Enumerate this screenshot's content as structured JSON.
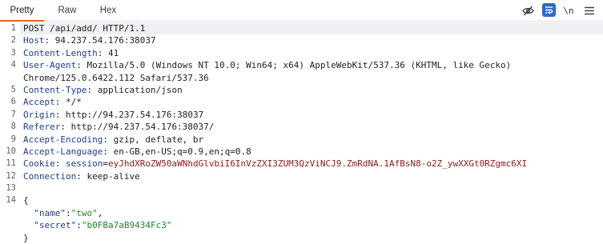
{
  "tabs": [
    "Pretty",
    "Raw",
    "Hex"
  ],
  "toolbar": {
    "hide_icon": "eye-slash-icon",
    "wrap_icon": "word-wrap-icon",
    "newline_label": "\\n",
    "accent": "#2f68c8"
  },
  "colors": {
    "active_tab_underline": "#e8622d",
    "header_name": "#1f3d8f",
    "cookie_value": "#8a1a1a",
    "json_string": "#178a26"
  },
  "line_numbers": [
    "1",
    "2",
    "3",
    "4",
    "",
    "5",
    "6",
    "7",
    "8",
    "9",
    "10",
    "11",
    "12",
    "13",
    "14",
    "",
    "",
    ""
  ],
  "request": {
    "request_line": "POST /api/add/ HTTP/1.1",
    "headers": [
      {
        "name": "Host",
        "value": "94.237.54.176:38037"
      },
      {
        "name": "Content-Length",
        "value": "41"
      },
      {
        "name": "User-Agent",
        "value": "Mozilla/5.0 (Windows NT 10.0; Win64; x64) AppleWebKit/537.36 (KHTML, like Gecko)"
      },
      {
        "name": "",
        "value": "Chrome/125.0.6422.112 Safari/537.36"
      },
      {
        "name": "Content-Type",
        "value": "application/json"
      },
      {
        "name": "Accept",
        "value": "*/*"
      },
      {
        "name": "Origin",
        "value": "http://94.237.54.176:38037"
      },
      {
        "name": "Referer",
        "value": "http://94.237.54.176:38037/"
      },
      {
        "name": "Accept-Encoding",
        "value": "gzip, deflate, br"
      },
      {
        "name": "Accept-Language",
        "value": "en-GB,en-US;q=0.9,en;q=0.8"
      }
    ],
    "cookie": {
      "name": "Cookie",
      "cookie_name": "session",
      "cookie_value": "eyJhdXRoZW50aWNhdGlvbiI6InVzZXI3ZUM3QzViNCJ9.ZmRdNA.1AfBsN8-o2Z_ywXXGt0RZgmc6XI"
    },
    "connection": {
      "name": "Connection",
      "value": "keep-alive"
    },
    "body": {
      "open": "{",
      "close": "}",
      "fields": [
        {
          "key": "\"name\"",
          "value": "\"two\"",
          "suffix": ","
        },
        {
          "key": "\"secret\"",
          "value": "\"b0FBa7aB9434Fc3\"",
          "suffix": ""
        }
      ]
    }
  }
}
